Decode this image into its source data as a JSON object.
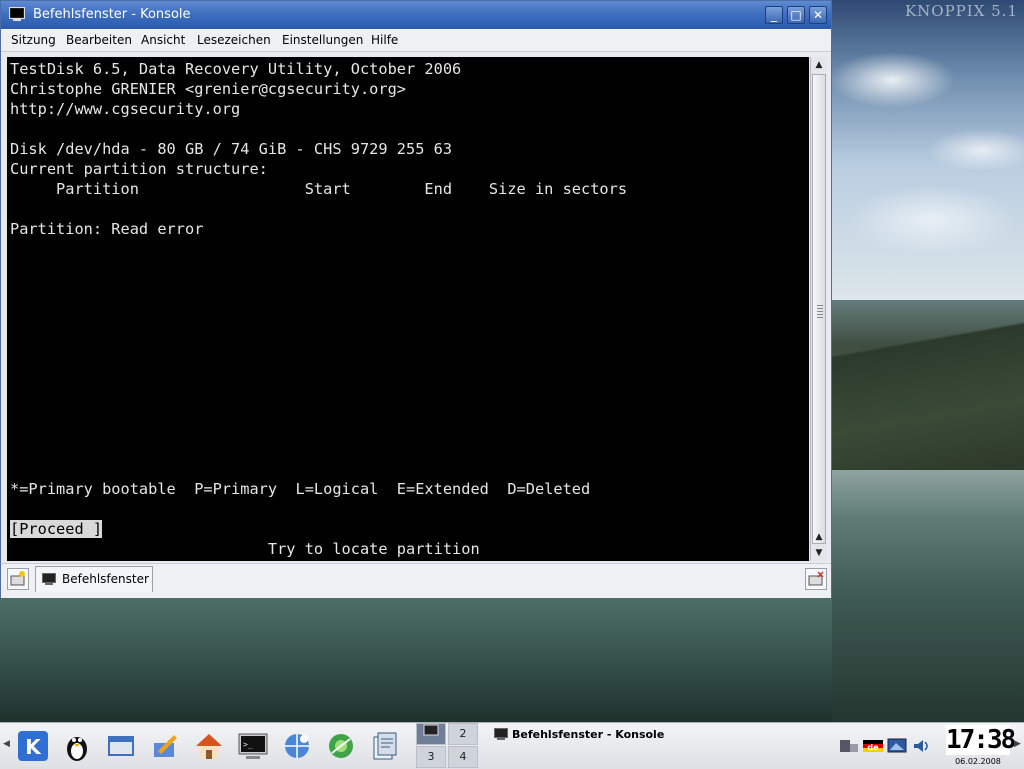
{
  "desktop": {
    "watermark": "KNOPPIX 5.1"
  },
  "window": {
    "title": "Befehlsfenster - Konsole",
    "buttons": {
      "minimize": "_",
      "maximize": "□",
      "close": "✕"
    }
  },
  "menubar": {
    "items": [
      "Sitzung",
      "Bearbeiten",
      "Ansicht",
      "Lesezeichen",
      "Einstellungen",
      "Hilfe"
    ]
  },
  "terminal": {
    "lines": [
      "TestDisk 6.5, Data Recovery Utility, October 2006",
      "Christophe GRENIER <grenier@cgsecurity.org>",
      "http://www.cgsecurity.org",
      "",
      "Disk /dev/hda - 80 GB / 74 GiB - CHS 9729 255 63",
      "Current partition structure:",
      "     Partition                  Start        End    Size in sectors",
      "",
      "Partition: Read error",
      "*=Primary bootable  P=Primary  L=Logical  E=Extended  D=Deleted",
      "[Proceed ]",
      "                            Try to locate partition"
    ]
  },
  "tabbar": {
    "tab_label": "Befehlsfenster"
  },
  "panel": {
    "pager_desktops": [
      "1",
      "2",
      "3",
      "4"
    ],
    "task_label": "Befehlsfenster - Konsole",
    "clock_time": "17:38",
    "clock_date": "06.02.2008",
    "launchers": [
      "kde-menu-icon",
      "tux-icon",
      "window-list-icon",
      "editor-icon",
      "home-icon",
      "terminal-icon",
      "browser-icon",
      "network-icon",
      "document-icon"
    ],
    "tray": [
      "kde-tray-icon",
      "keyboard-layout-de-icon",
      "display-icon",
      "volume-icon"
    ]
  }
}
